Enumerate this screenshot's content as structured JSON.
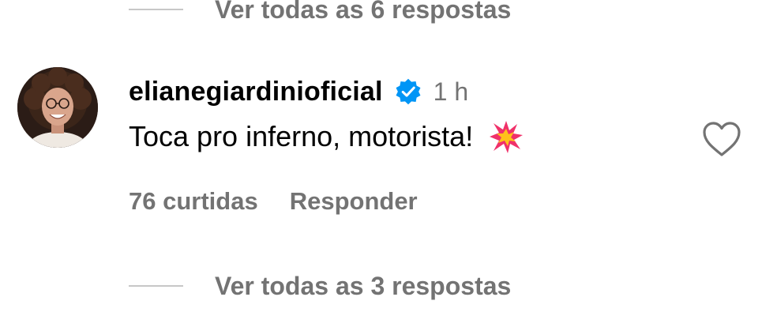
{
  "replies_top": {
    "label": "Ver todas as 6 respostas"
  },
  "comment": {
    "username": "elianegiardinioficial",
    "verified_icon": "verified-badge-icon",
    "time": "1 h",
    "text": "Toca pro inferno, motorista!",
    "emoji_icon": "collision-emoji-icon",
    "likes": "76 curtidas",
    "reply_label": "Responder",
    "like_icon": "heart-outline-icon"
  },
  "replies_bottom": {
    "label": "Ver todas as 3 respostas"
  },
  "colors": {
    "secondary_text": "#737373",
    "verified_blue": "#0095f6",
    "divider": "#c7c7c7"
  }
}
